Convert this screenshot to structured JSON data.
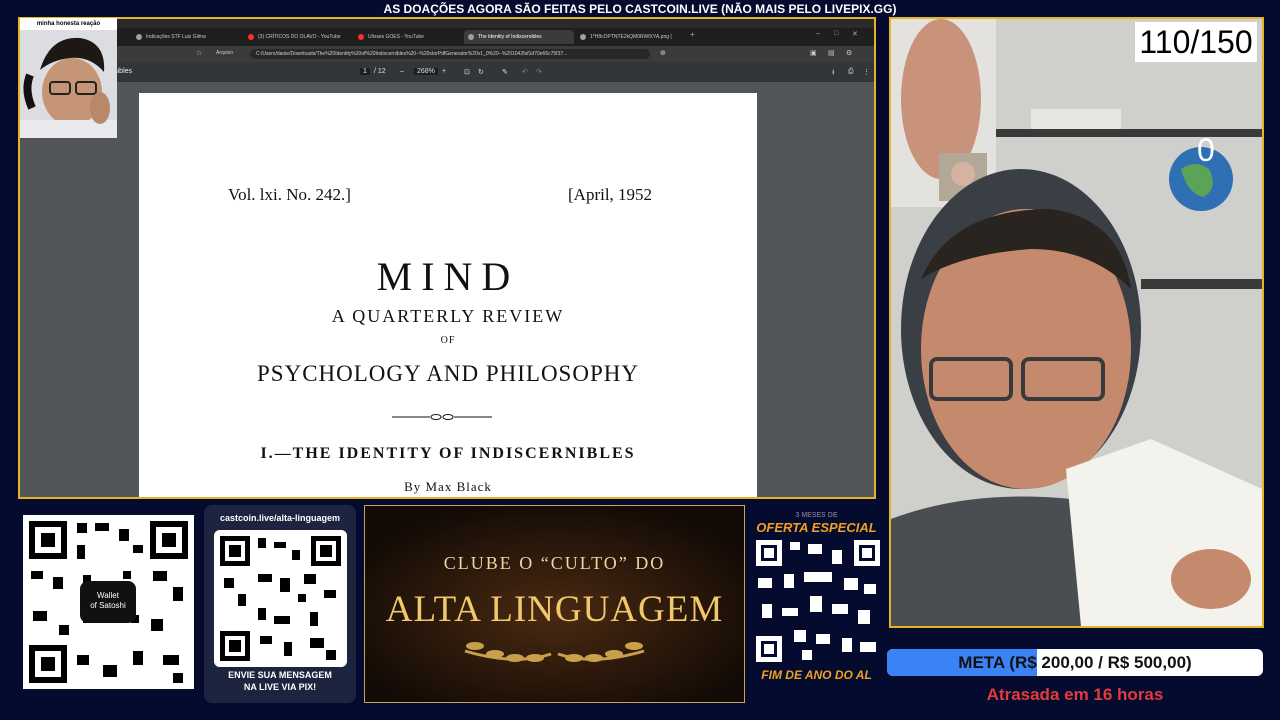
{
  "ticker": {
    "text": "AS DOAÇÕES AGORA SÃO FEITAS PELO CASTCOIN.LIVE (NÃO MAIS PELO LIVEPIX.GG)"
  },
  "webcam_small": {
    "label": "minha honesta reação"
  },
  "browser": {
    "tabs": [
      {
        "title": "Indicações STF Luiz Gilma",
        "icon_color": "#9aa0a6"
      },
      {
        "title": "(3) CRÍTICOS DO OLAVO - YouTube",
        "icon_color": "#ff2d2d"
      },
      {
        "title": "Ulisses GOES - YouTube",
        "icon_color": "#ff2d2d"
      },
      {
        "title": "The Identity of Indiscernibles",
        "icon_color": "#9aa0a6",
        "active": true
      },
      {
        "title": "1*H8cOPTNTE2kQM0RWfXYA.png (",
        "icon_color": "#9aa0a6"
      }
    ],
    "address_prefix": "Arquivo",
    "address": "C:/Users/danie/Downloads/The%20Identity%20of%20Indiscernibles%20--%20storPdfGenerator%20v1_0%20--%201042faf1d70e66c75f37...",
    "doc_title": "cernibles",
    "page_current": "1",
    "page_total": "/ 12",
    "zoom": "268%"
  },
  "pdf": {
    "volume": "Vol. lxi.   No. 242.]",
    "date": "[April, 1952",
    "journal": "MIND",
    "subtitle": "A QUARTERLY REVIEW",
    "of": "OF",
    "field": "PSYCHOLOGY AND PHILOSOPHY",
    "article": "I.—THE IDENTITY OF INDISCERNIBLES",
    "author": "By Max Black"
  },
  "stream": {
    "counter": "110/150",
    "likes": "0"
  },
  "qr_wallet": {
    "label_line1": "Wallet",
    "label_line2": "of Satoshi"
  },
  "castcoin": {
    "url": "castcoin.live/alta-linguagem",
    "footer_line1": "ENVIE SUA MENSAGEM",
    "footer_line2": "NA LIVE VIA PIX!"
  },
  "club": {
    "subtitle": "CLUBE O “CULTO” DO",
    "title": "ALTA LINGUAGEM"
  },
  "offer": {
    "tiny": "3 MESES DE",
    "top": "OFERTA ESPECIAL",
    "bottom": "FIM DE ANO DO AL"
  },
  "goal": {
    "text": "META (R$ 200,00 / R$ 500,00)",
    "raised": 200,
    "target": 500,
    "status": "Atrasada em 16 horas"
  },
  "colors": {
    "accent_gold": "#e6b422",
    "goal_fill": "#3b82f6",
    "late_red": "#e33b3b"
  }
}
